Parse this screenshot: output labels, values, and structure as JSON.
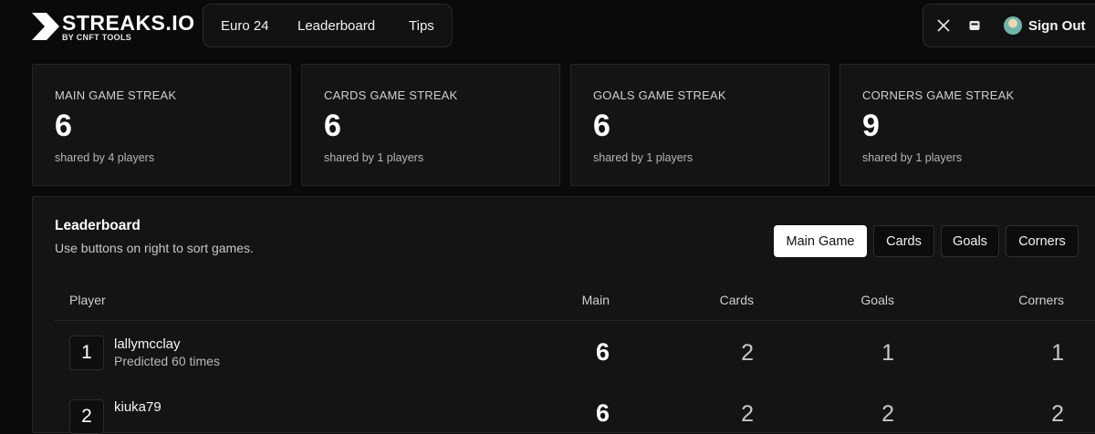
{
  "brand": {
    "title": "STREAKS.IO",
    "subtitle": "BY CNFT TOOLS"
  },
  "nav": {
    "items": [
      "Euro 24",
      "Leaderboard",
      "Tips"
    ]
  },
  "user": {
    "signout_label": "Sign Out",
    "icons": [
      "x-icon",
      "chat-icon",
      "avatar"
    ]
  },
  "stats": [
    {
      "label": "MAIN GAME STREAK",
      "value": "6",
      "sub": "shared by 4 players"
    },
    {
      "label": "CARDS GAME STREAK",
      "value": "6",
      "sub": "shared by 1 players"
    },
    {
      "label": "GOALS GAME STREAK",
      "value": "6",
      "sub": "shared by 1 players"
    },
    {
      "label": "CORNERS GAME STREAK",
      "value": "9",
      "sub": "shared by 1 players"
    }
  ],
  "leaderboard": {
    "title": "Leaderboard",
    "subtitle": "Use buttons on right to sort games.",
    "sort_buttons": [
      "Main Game",
      "Cards",
      "Goals",
      "Corners"
    ],
    "active_sort": "Main Game",
    "columns": [
      "Player",
      "Main",
      "Cards",
      "Goals",
      "Corners"
    ],
    "rows": [
      {
        "rank": "1",
        "name": "lallymcclay",
        "sub": "Predicted 60 times",
        "main": "6",
        "cards": "2",
        "goals": "1",
        "corners": "1"
      },
      {
        "rank": "2",
        "name": "kiuka79",
        "sub": "",
        "main": "6",
        "cards": "2",
        "goals": "2",
        "corners": "2"
      }
    ]
  },
  "colors": {
    "background": "#0a0a0a",
    "card": "#141414",
    "border": "#262626",
    "active_button": "#ffffff"
  }
}
